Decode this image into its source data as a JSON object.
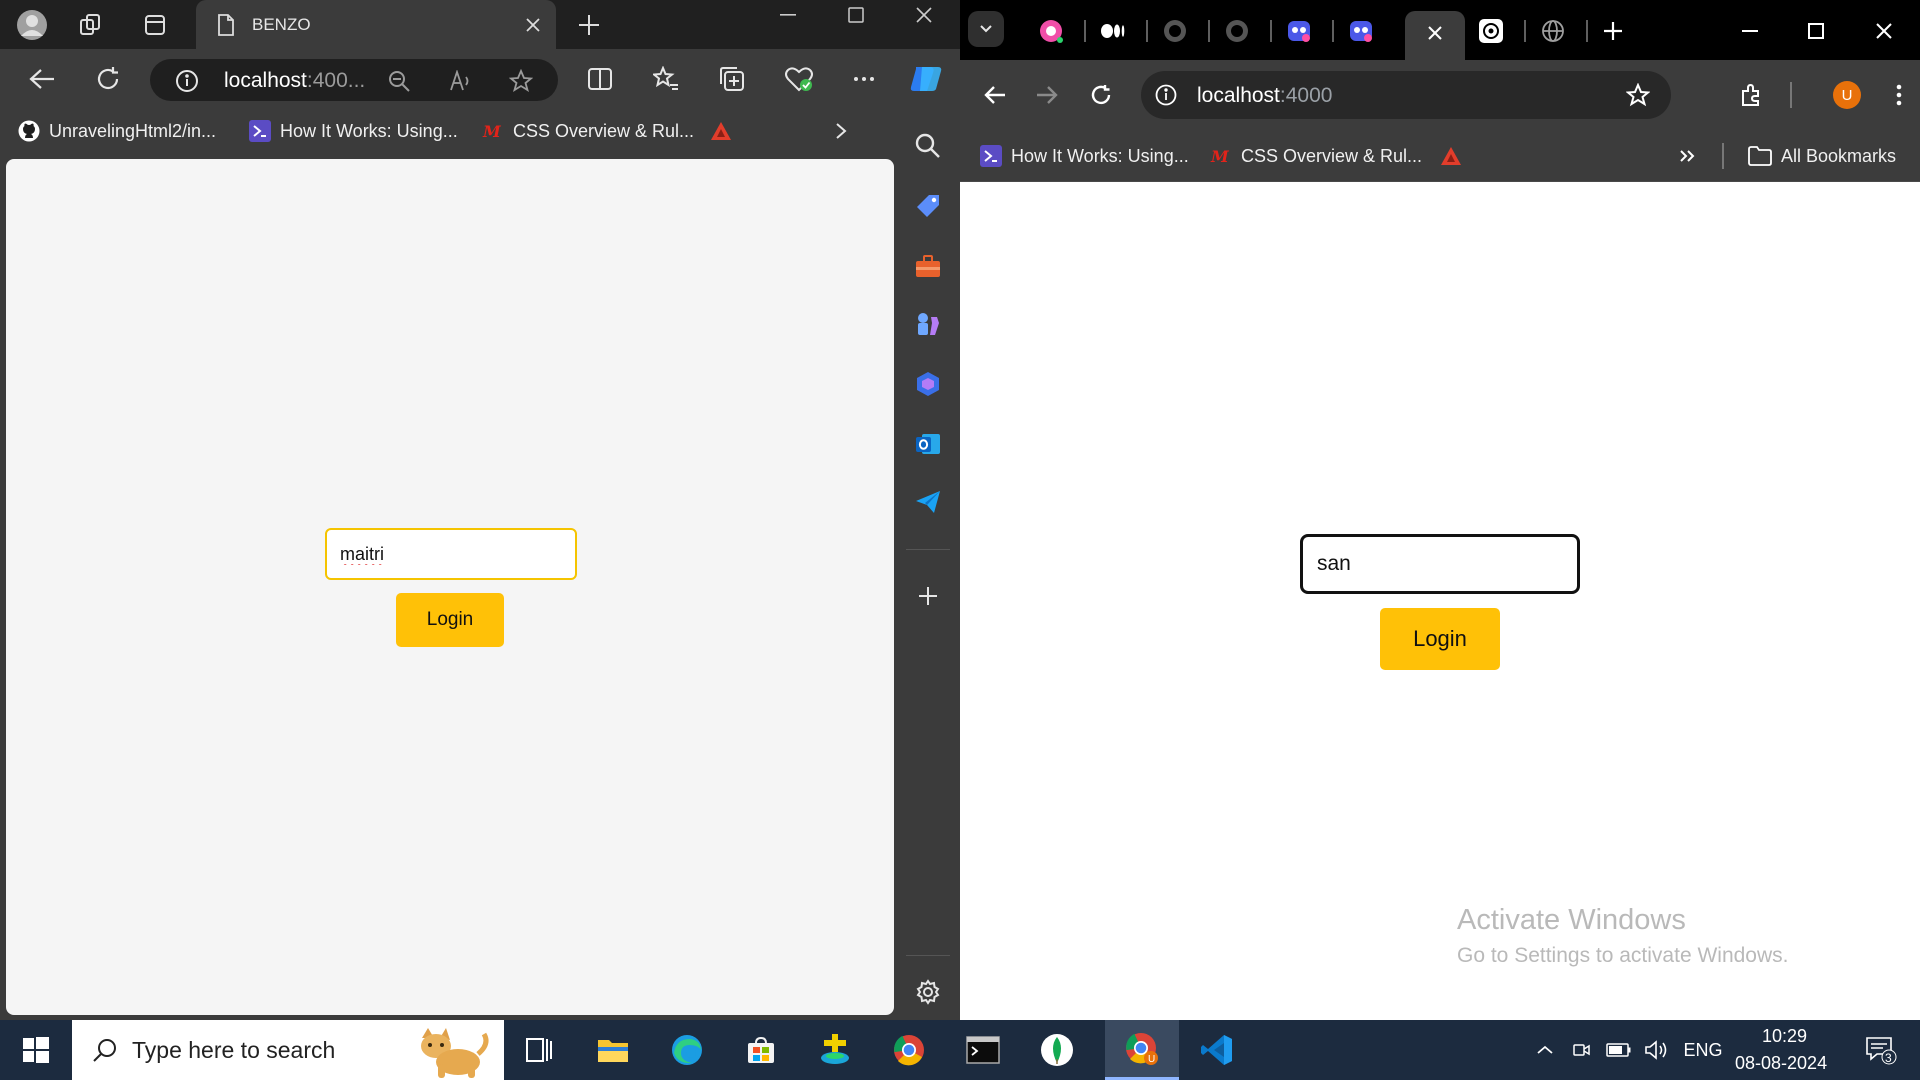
{
  "edge": {
    "tab_title": "BENZO",
    "url_host": "localhost",
    "url_rest": ":400...",
    "favorites": [
      {
        "label": "UnravelingHtml2/in...",
        "icon": "github-icon"
      },
      {
        "label": "How It Works: Using...",
        "icon": "powershell-icon"
      },
      {
        "label": "CSS Overview & Rul...",
        "icon": "mdn-icon"
      },
      {
        "label": "",
        "icon": "red-triangle-icon"
      }
    ],
    "login": {
      "input_value": "maitri",
      "button_label": "Login"
    },
    "sidebar_icons": [
      "search-icon",
      "shopping-tag-icon",
      "tools-icon",
      "games-icon",
      "copilot-icon",
      "outlook-icon",
      "send-icon",
      "add-icon",
      "settings-icon"
    ]
  },
  "chrome": {
    "url_host": "localhost",
    "url_rest": ":4000",
    "profile_initial": "U",
    "favorites": [
      {
        "label": "How It Works: Using...",
        "icon": "powershell-icon"
      },
      {
        "label": "CSS Overview & Rul...",
        "icon": "mdn-icon"
      },
      {
        "label": "",
        "icon": "red-triangle-icon"
      }
    ],
    "all_bookmarks": "All Bookmarks",
    "login": {
      "input_value": "san",
      "button_label": "Login"
    }
  },
  "watermark": {
    "title": "Activate Windows",
    "subtitle": "Go to Settings to activate Windows."
  },
  "taskbar": {
    "search_placeholder": "Type here to search",
    "apps": [
      "task-view-icon",
      "file-explorer-icon",
      "edge-icon",
      "store-icon",
      "app-icon",
      "chrome-icon",
      "terminal-icon",
      "mongodb-icon",
      "chrome-profile-icon",
      "vscode-icon"
    ],
    "language": "ENG",
    "time": "10:29",
    "date": "08-08-2024",
    "notification_count": "3"
  },
  "colors": {
    "accent_yellow": "#ffc107",
    "edge_chrome": "#3b3b3b",
    "chrome_dark": "#202124",
    "taskbar": "#1c2b3f"
  }
}
